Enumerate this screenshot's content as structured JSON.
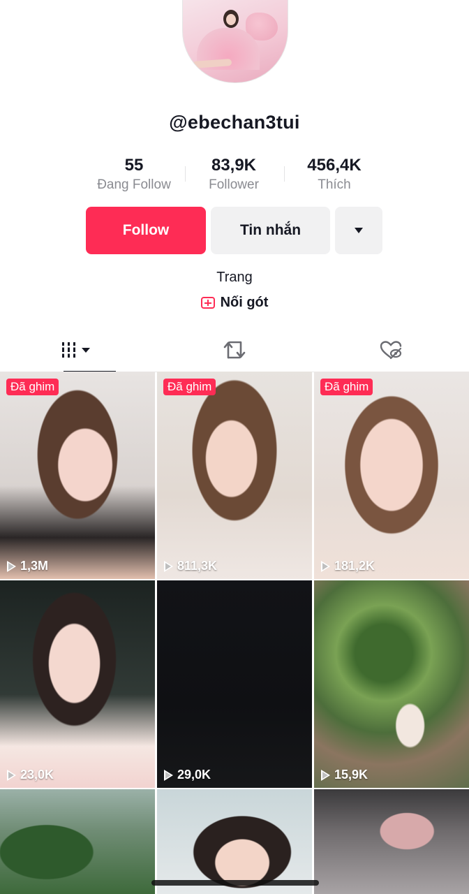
{
  "profile": {
    "username": "@ebechan3tui",
    "bio": "Trang",
    "link_label": "Nối gót"
  },
  "stats": [
    {
      "value": "55",
      "label": "Đang Follow"
    },
    {
      "value": "83,9K",
      "label": "Follower"
    },
    {
      "value": "456,4K",
      "label": "Thích"
    }
  ],
  "actions": {
    "follow_label": "Follow",
    "message_label": "Tin nhắn",
    "more_icon": "dropdown-arrow-icon"
  },
  "tabs": [
    {
      "icon": "videos-grid-icon",
      "active": true
    },
    {
      "icon": "repost-icon",
      "active": false
    },
    {
      "icon": "liked-hidden-icon",
      "active": false
    }
  ],
  "videos": [
    {
      "pinned_label": "Đã ghim",
      "views": "1,3M"
    },
    {
      "pinned_label": "Đã ghim",
      "views": "811,3K"
    },
    {
      "pinned_label": "Đã ghim",
      "views": "181,2K"
    },
    {
      "pinned_label": "",
      "views": "23,0K"
    },
    {
      "pinned_label": "",
      "views": "29,0K"
    },
    {
      "pinned_label": "",
      "views": "15,9K"
    },
    {
      "pinned_label": "",
      "views": ""
    },
    {
      "pinned_label": "",
      "views": ""
    },
    {
      "pinned_label": "",
      "views": ""
    }
  ],
  "colors": {
    "accent": "#fe2c55",
    "button_gray": "#f1f1f2",
    "text": "#161823",
    "muted": "#8a8b91"
  }
}
